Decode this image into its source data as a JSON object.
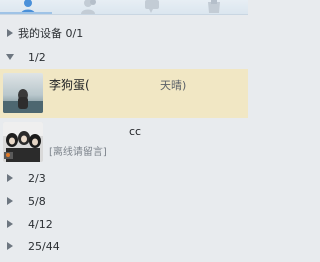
{
  "tabs": [
    {
      "name": "contacts",
      "icon": "person-icon",
      "active": true
    },
    {
      "name": "groups",
      "icon": "group-icon",
      "active": false
    },
    {
      "name": "messages",
      "icon": "chat-icon",
      "active": false
    },
    {
      "name": "apps",
      "icon": "app-icon",
      "active": false
    }
  ],
  "my_devices": {
    "label": "我的设备 0/1"
  },
  "groups": [
    {
      "count": "1/2",
      "expanded": true
    },
    {
      "count": "2/3",
      "expanded": false
    },
    {
      "count": "5/8",
      "expanded": false
    },
    {
      "count": "4/12",
      "expanded": false
    },
    {
      "count": "25/44",
      "expanded": false
    }
  ],
  "contacts": [
    {
      "name": "李狗蛋(",
      "status": "天晴)",
      "selected": true
    },
    {
      "name": "cc",
      "signature": "[离线请留言]",
      "selected": false
    }
  ],
  "colors": {
    "selected_row": "#f1e7c4",
    "background": "#e8ebee",
    "active_tab": "#4a90d9"
  }
}
